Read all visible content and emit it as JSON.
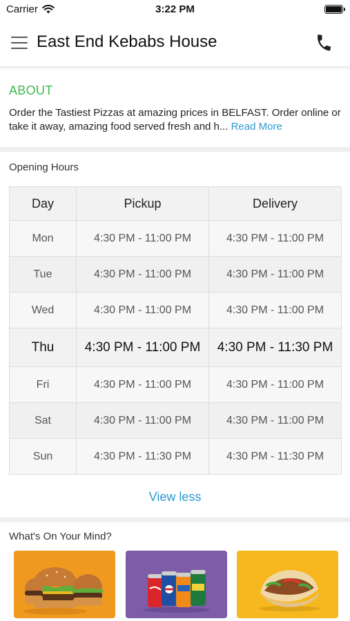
{
  "status_bar": {
    "carrier": "Carrier",
    "time": "3:22 PM"
  },
  "header": {
    "title": "East End Kebabs House"
  },
  "about": {
    "title": "ABOUT",
    "text": "Order the Tastiest Pizzas at amazing prices in BELFAST. Order online or take it away, amazing food served fresh and h...",
    "read_more": "Read More"
  },
  "opening_hours": {
    "label": "Opening Hours",
    "columns": [
      "Day",
      "Pickup",
      "Delivery"
    ],
    "rows": [
      {
        "day": "Mon",
        "pickup": "4:30 PM - 11:00 PM",
        "delivery": "4:30 PM - 11:00 PM"
      },
      {
        "day": "Tue",
        "pickup": "4:30 PM - 11:00 PM",
        "delivery": "4:30 PM - 11:00 PM"
      },
      {
        "day": "Wed",
        "pickup": "4:30 PM - 11:00 PM",
        "delivery": "4:30 PM - 11:00 PM"
      },
      {
        "day": "Thu",
        "pickup": "4:30 PM - 11:00 PM",
        "delivery": "4:30 PM - 11:30 PM"
      },
      {
        "day": "Fri",
        "pickup": "4:30 PM - 11:00 PM",
        "delivery": "4:30 PM - 11:00 PM"
      },
      {
        "day": "Sat",
        "pickup": "4:30 PM - 11:00 PM",
        "delivery": "4:30 PM - 11:00 PM"
      },
      {
        "day": "Sun",
        "pickup": "4:30 PM - 11:30 PM",
        "delivery": "4:30 PM - 11:30 PM"
      }
    ],
    "view_less": "View less"
  },
  "mind_section": {
    "label": "What's On Your Mind?",
    "cards": [
      {
        "icon": "burger-icon",
        "color": "#ef9a1f"
      },
      {
        "icon": "soft-drinks-icon",
        "color": "#7d5ca8"
      },
      {
        "icon": "kebab-wrap-icon",
        "color": "#f6b81e"
      }
    ]
  },
  "colors": {
    "accent_green": "#3dba4e",
    "link_blue": "#2d9ad1"
  }
}
